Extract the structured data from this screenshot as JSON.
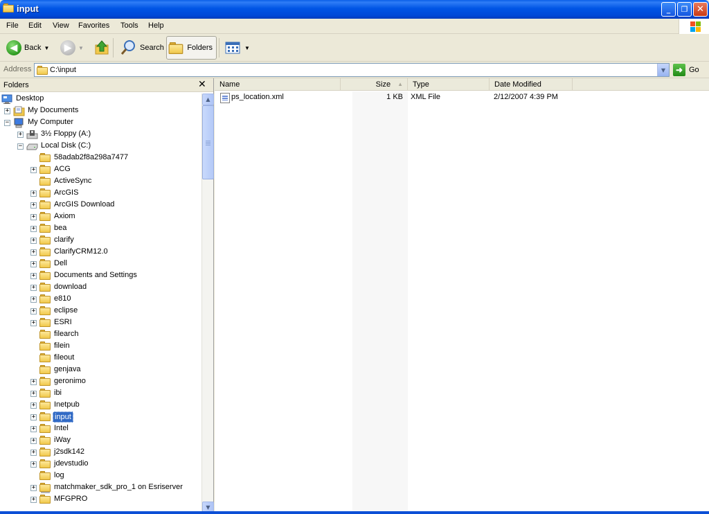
{
  "window": {
    "title": "input"
  },
  "menu": [
    "File",
    "Edit",
    "View",
    "Favorites",
    "Tools",
    "Help"
  ],
  "toolbar": {
    "back": "Back",
    "search": "Search",
    "folders": "Folders"
  },
  "address": {
    "label": "Address",
    "value": "C:\\input",
    "go": "Go"
  },
  "folders_pane": {
    "title": "Folders",
    "tree": [
      {
        "label": "Desktop",
        "level": 0,
        "icon": "desktop-icon",
        "expander": ""
      },
      {
        "label": "My Documents",
        "level": 1,
        "icon": "my-documents-icon",
        "expander": "+"
      },
      {
        "label": "My Computer",
        "level": 1,
        "icon": "my-computer-icon",
        "expander": "-"
      },
      {
        "label": "3½ Floppy (A:)",
        "level": 2,
        "icon": "floppy-drive-icon",
        "expander": "+"
      },
      {
        "label": "Local Disk (C:)",
        "level": 2,
        "icon": "hard-drive-icon",
        "expander": "-"
      },
      {
        "label": "58adab2f8a298a7477",
        "level": 3,
        "icon": "folder-icon",
        "expander": ""
      },
      {
        "label": "ACG",
        "level": 3,
        "icon": "folder-icon",
        "expander": "+"
      },
      {
        "label": "ActiveSync",
        "level": 3,
        "icon": "folder-icon",
        "expander": ""
      },
      {
        "label": "ArcGIS",
        "level": 3,
        "icon": "folder-icon",
        "expander": "+"
      },
      {
        "label": "ArcGIS Download",
        "level": 3,
        "icon": "folder-icon",
        "expander": "+"
      },
      {
        "label": "Axiom",
        "level": 3,
        "icon": "folder-icon",
        "expander": "+"
      },
      {
        "label": "bea",
        "level": 3,
        "icon": "folder-icon",
        "expander": "+"
      },
      {
        "label": "clarify",
        "level": 3,
        "icon": "folder-icon",
        "expander": "+"
      },
      {
        "label": "ClarifyCRM12.0",
        "level": 3,
        "icon": "folder-icon",
        "expander": "+"
      },
      {
        "label": "Dell",
        "level": 3,
        "icon": "folder-icon",
        "expander": "+"
      },
      {
        "label": "Documents and Settings",
        "level": 3,
        "icon": "folder-icon",
        "expander": "+"
      },
      {
        "label": "download",
        "level": 3,
        "icon": "folder-icon",
        "expander": "+"
      },
      {
        "label": "e810",
        "level": 3,
        "icon": "folder-icon",
        "expander": "+"
      },
      {
        "label": "eclipse",
        "level": 3,
        "icon": "folder-icon",
        "expander": "+"
      },
      {
        "label": "ESRI",
        "level": 3,
        "icon": "folder-icon",
        "expander": "+"
      },
      {
        "label": "filearch",
        "level": 3,
        "icon": "folder-icon",
        "expander": ""
      },
      {
        "label": "filein",
        "level": 3,
        "icon": "folder-icon",
        "expander": ""
      },
      {
        "label": "fileout",
        "level": 3,
        "icon": "folder-icon",
        "expander": ""
      },
      {
        "label": "genjava",
        "level": 3,
        "icon": "folder-icon",
        "expander": ""
      },
      {
        "label": "geronimo",
        "level": 3,
        "icon": "folder-icon",
        "expander": "+"
      },
      {
        "label": "ibi",
        "level": 3,
        "icon": "folder-icon",
        "expander": "+"
      },
      {
        "label": "Inetpub",
        "level": 3,
        "icon": "folder-icon",
        "expander": "+"
      },
      {
        "label": "input",
        "level": 3,
        "icon": "folder-open-icon",
        "expander": "+",
        "selected": true
      },
      {
        "label": "Intel",
        "level": 3,
        "icon": "folder-icon",
        "expander": "+"
      },
      {
        "label": "iWay",
        "level": 3,
        "icon": "folder-icon",
        "expander": "+"
      },
      {
        "label": "j2sdk142",
        "level": 3,
        "icon": "folder-icon",
        "expander": "+"
      },
      {
        "label": "jdevstudio",
        "level": 3,
        "icon": "folder-icon",
        "expander": "+"
      },
      {
        "label": "log",
        "level": 3,
        "icon": "folder-icon",
        "expander": ""
      },
      {
        "label": "matchmaker_sdk_pro_1 on Esriserver",
        "level": 3,
        "icon": "network-folder-icon",
        "expander": "+"
      },
      {
        "label": "MFGPRO",
        "level": 3,
        "icon": "folder-icon",
        "expander": "+"
      }
    ]
  },
  "file_list": {
    "columns": [
      "Name",
      "Size",
      "Type",
      "Date Modified"
    ],
    "rows": [
      {
        "name": "ps_location.xml",
        "size": "1 KB",
        "type": "XML File",
        "modified": "2/12/2007 4:39 PM"
      }
    ]
  },
  "colors": {
    "titlebar": "#0055e5",
    "selection": "#316ac5",
    "chrome": "#ece9d8"
  }
}
